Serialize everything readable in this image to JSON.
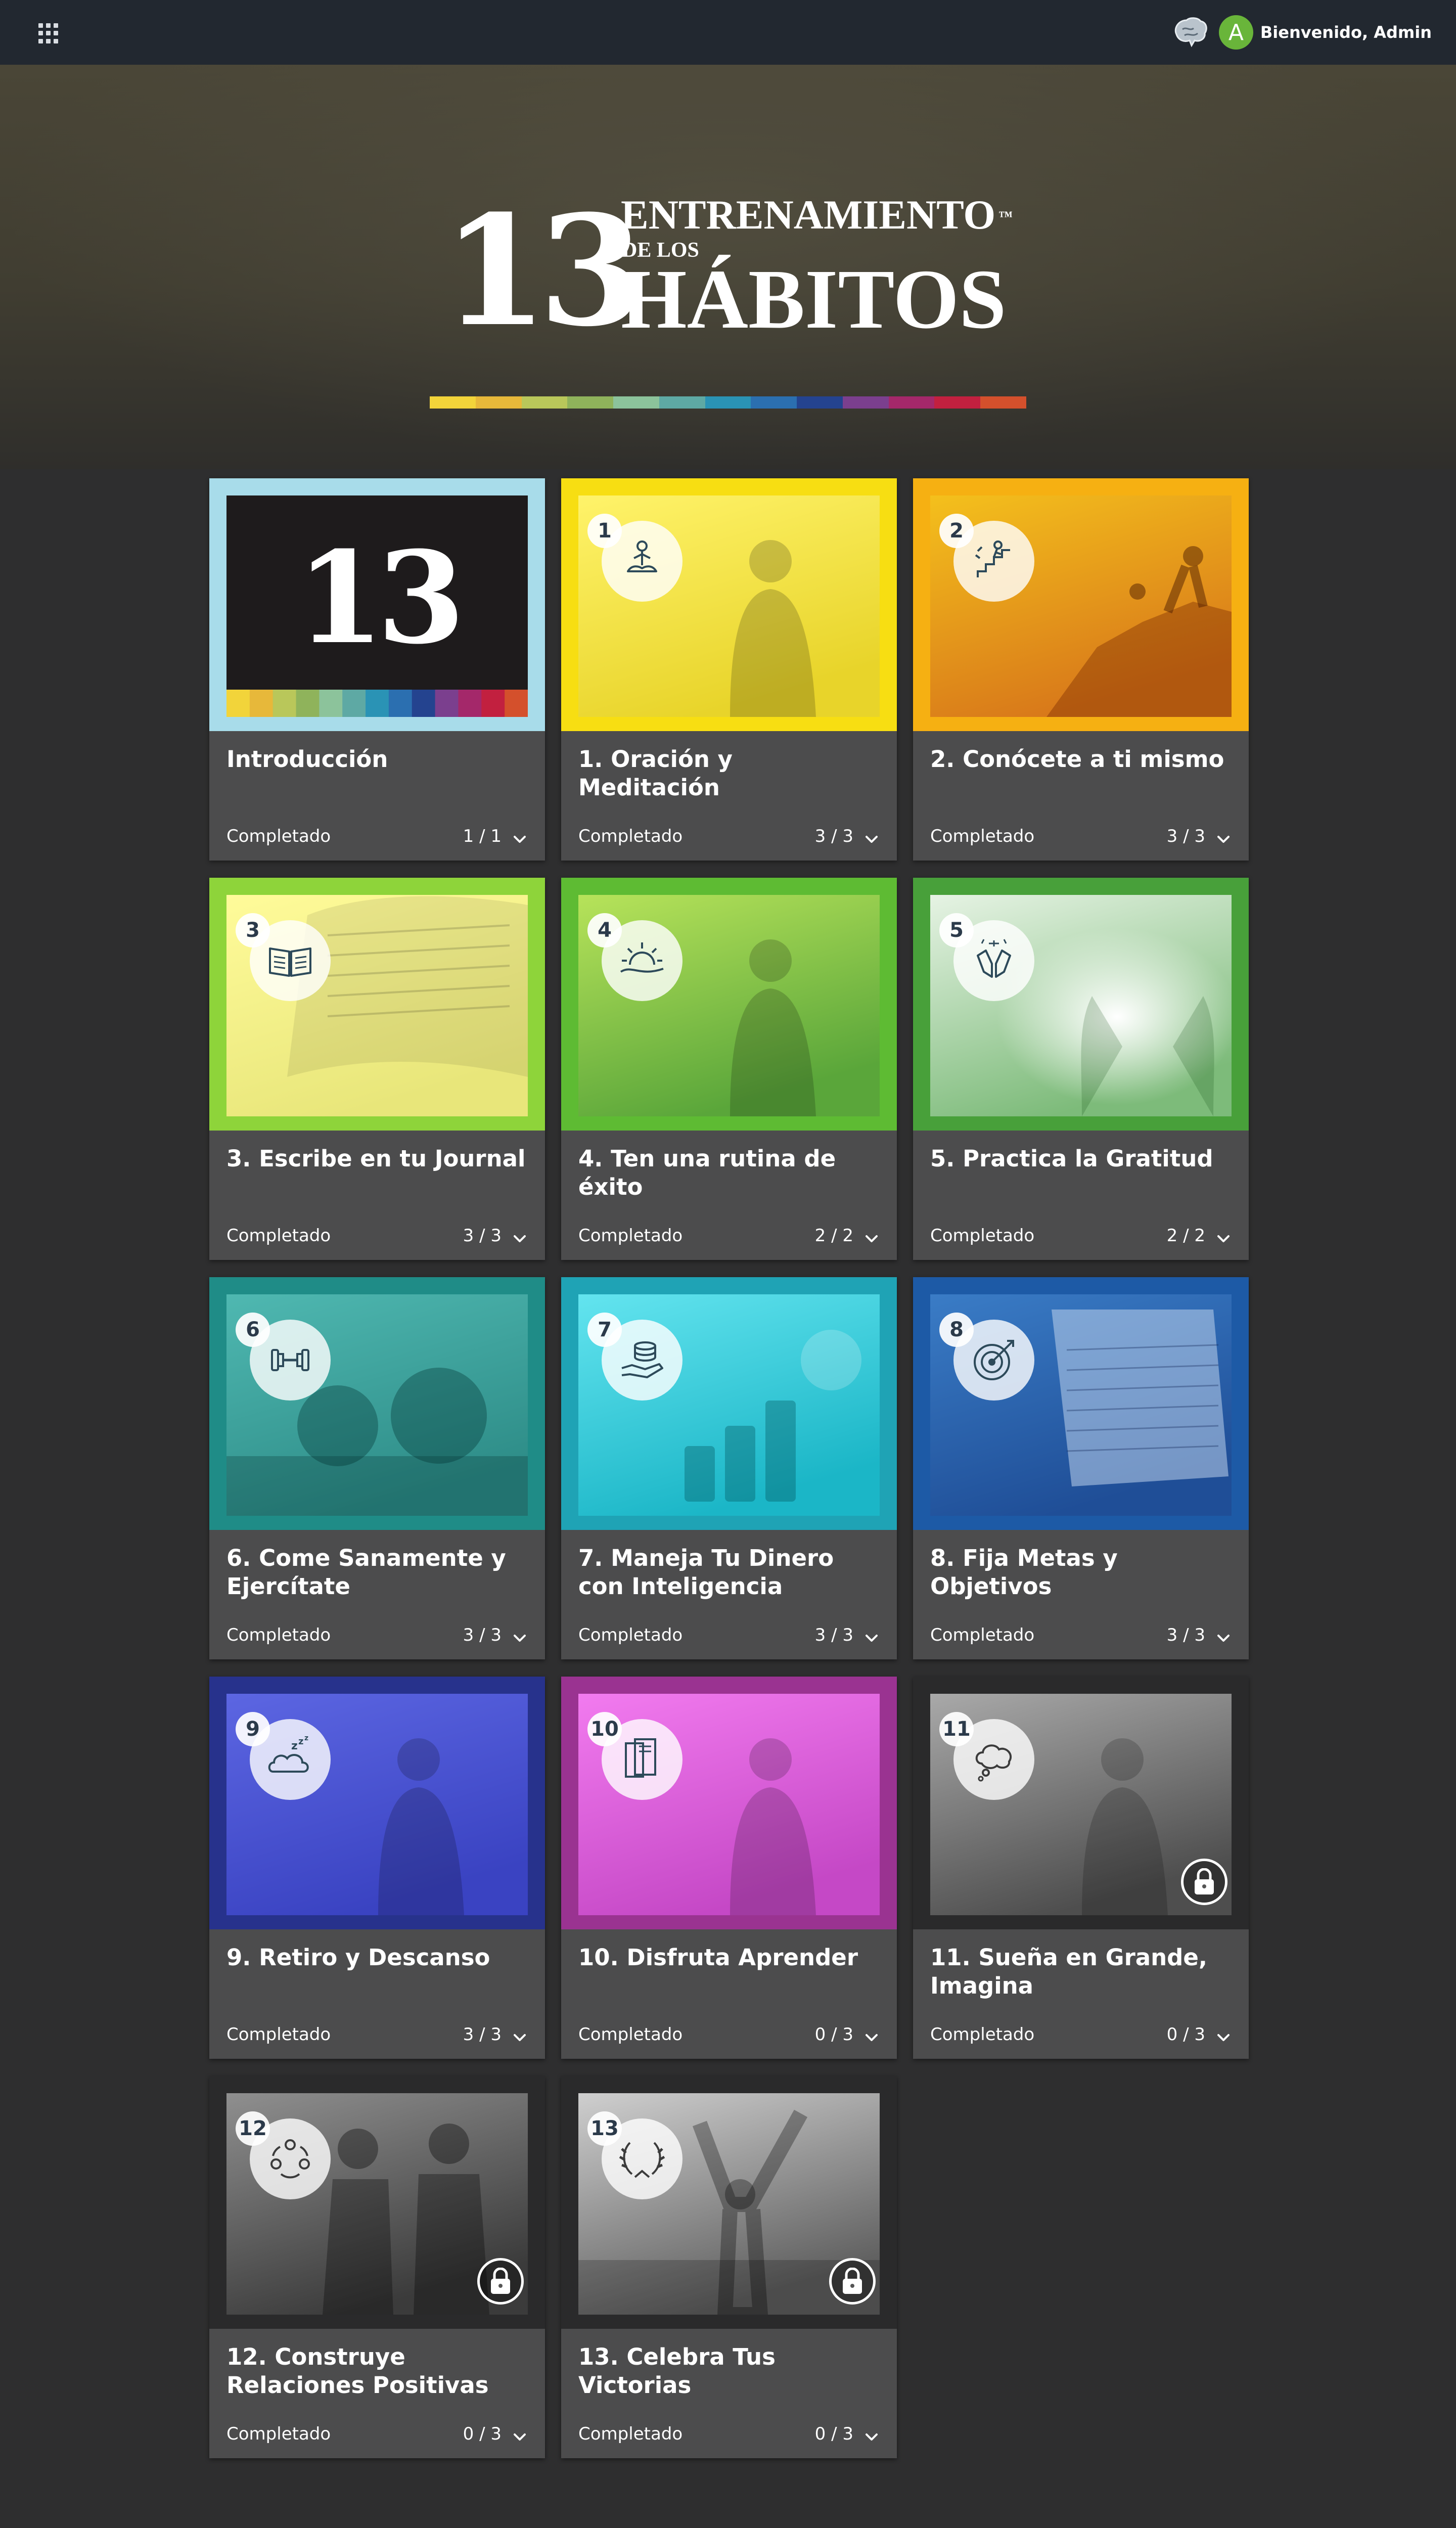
{
  "header": {
    "apps_icon": "grid-icon",
    "brand_icon": "brain-logo-icon",
    "avatar_letter": "A",
    "welcome": "Bienvenido, Admin"
  },
  "hero": {
    "number": "13",
    "line1": "ENTRENAMIENTO",
    "tm": "™",
    "line2": "DE LOS",
    "line3": "HÁBITOS",
    "stripe_colors": [
      "#f2d43a",
      "#e7b83a",
      "#b9c75a",
      "#8fb35b",
      "#8cc39b",
      "#5ea9a4",
      "#2a93b5",
      "#2b6fb0",
      "#24438f",
      "#7b3f8e",
      "#a4286a",
      "#c2203f",
      "#d4502c"
    ]
  },
  "courses": [
    {
      "number": "",
      "title": "Introducción",
      "status": "Completado",
      "progress": "1 / 1",
      "locked": false,
      "frame": "#a8dcea",
      "icon": "intro-13-icon"
    },
    {
      "number": "1",
      "title": "1. Oración y Meditación",
      "status": "Completado",
      "progress": "3 / 3",
      "locked": false,
      "frame": "#f7de12",
      "icon": "meditation-icon"
    },
    {
      "number": "2",
      "title": "2. Conócete a ti mismo",
      "status": "Completado",
      "progress": "3 / 3",
      "locked": false,
      "frame": "#f6b012",
      "icon": "climb-stairs-icon"
    },
    {
      "number": "3",
      "title": "3. Escribe en tu Journal",
      "status": "Completado",
      "progress": "3 / 3",
      "locked": false,
      "frame": "#8ed43a",
      "icon": "open-book-icon"
    },
    {
      "number": "4",
      "title": "4. Ten una rutina de éxito",
      "status": "Completado",
      "progress": "2 / 2",
      "locked": false,
      "frame": "#5ebb33",
      "icon": "sunrise-icon"
    },
    {
      "number": "5",
      "title": "5. Practica la Gratitud",
      "status": "Completado",
      "progress": "2 / 2",
      "locked": false,
      "frame": "#48a03a",
      "icon": "open-hands-icon"
    },
    {
      "number": "6",
      "title": "6. Come Sanamente y Ejercítate",
      "status": "Completado",
      "progress": "3 / 3",
      "locked": false,
      "frame": "#1f8c87",
      "icon": "dumbbell-icon"
    },
    {
      "number": "7",
      "title": "7. Maneja Tu Dinero con Inteligencia",
      "status": "Completado",
      "progress": "3 / 3",
      "locked": false,
      "frame": "#1fa3b5",
      "icon": "coins-hand-icon"
    },
    {
      "number": "8",
      "title": "8. Fija Metas y Objetivos",
      "status": "Completado",
      "progress": "3 / 3",
      "locked": false,
      "frame": "#1d5aa6",
      "icon": "target-icon"
    },
    {
      "number": "9",
      "title": "9. Retiro y Descanso",
      "status": "Completado",
      "progress": "3 / 3",
      "locked": false,
      "frame": "#27328c",
      "icon": "sleep-cloud-icon"
    },
    {
      "number": "10",
      "title": "10. Disfruta Aprender",
      "status": "Completado",
      "progress": "0 / 3",
      "locked": false,
      "frame": "#9a3391",
      "icon": "books-icon"
    },
    {
      "number": "11",
      "title": "11. Sueña en Grande, Imagina",
      "status": "Completado",
      "progress": "0 / 3",
      "locked": true,
      "frame": "#2a2a2b",
      "icon": "thought-bubble-icon"
    },
    {
      "number": "12",
      "title": "12. Construye Relaciones Positivas",
      "status": "Completado",
      "progress": "0 / 3",
      "locked": true,
      "frame": "#2a2a2b",
      "icon": "people-network-icon"
    },
    {
      "number": "13",
      "title": "13. Celebra Tus Victorias",
      "status": "Completado",
      "progress": "0 / 3",
      "locked": true,
      "frame": "#2a2a2b",
      "icon": "laurel-wreath-icon"
    }
  ]
}
